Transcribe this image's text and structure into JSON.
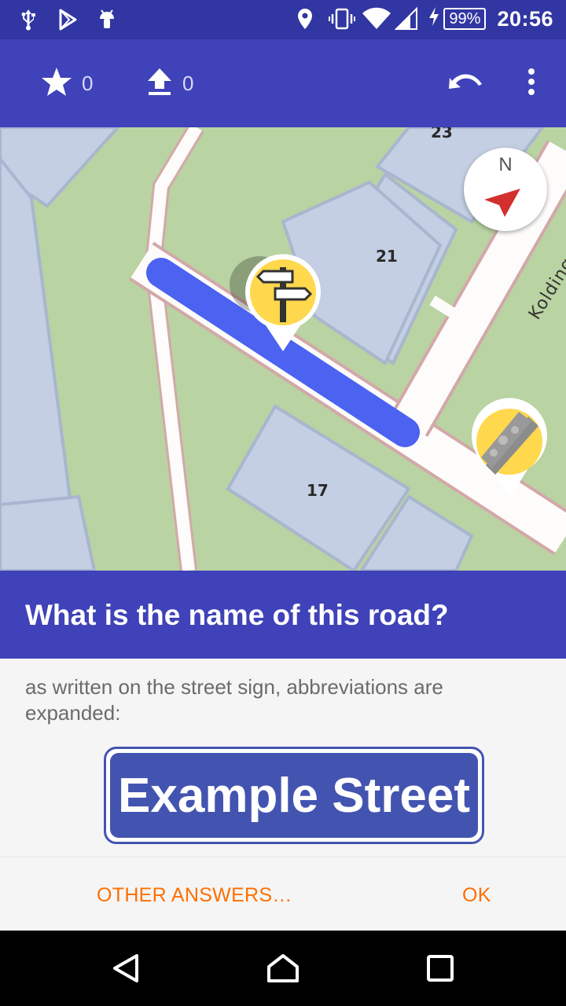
{
  "status_bar": {
    "battery": "99%",
    "time": "20:56",
    "left_icons": [
      "usb-icon",
      "play-store-icon",
      "android-icon"
    ],
    "right_icons": [
      "location-icon",
      "vibrate-icon",
      "wifi-icon",
      "signal-icon",
      "charging-icon"
    ]
  },
  "toolbar": {
    "stars_count": "0",
    "uploads_count": "0",
    "icons": [
      "star-icon",
      "upload-icon",
      "undo-icon",
      "overflow-menu-icon"
    ]
  },
  "map": {
    "compass_label": "N",
    "house_numbers": [
      "23",
      "21",
      "17"
    ],
    "street_label": "Kolding"
  },
  "quest": {
    "title": "What is the name of this road?",
    "hint": "as written on the street sign, abbreviations are expanded:",
    "sign_text": "Example Street"
  },
  "buttons": {
    "other_answers": "OTHER ANSWERS…",
    "ok": "OK"
  },
  "colors": {
    "primary": "#3f42b8",
    "status_bar": "#3136a2",
    "accent": "#ff6f00",
    "sign": "#4354b0",
    "highlight_road": "#4c62f0"
  }
}
